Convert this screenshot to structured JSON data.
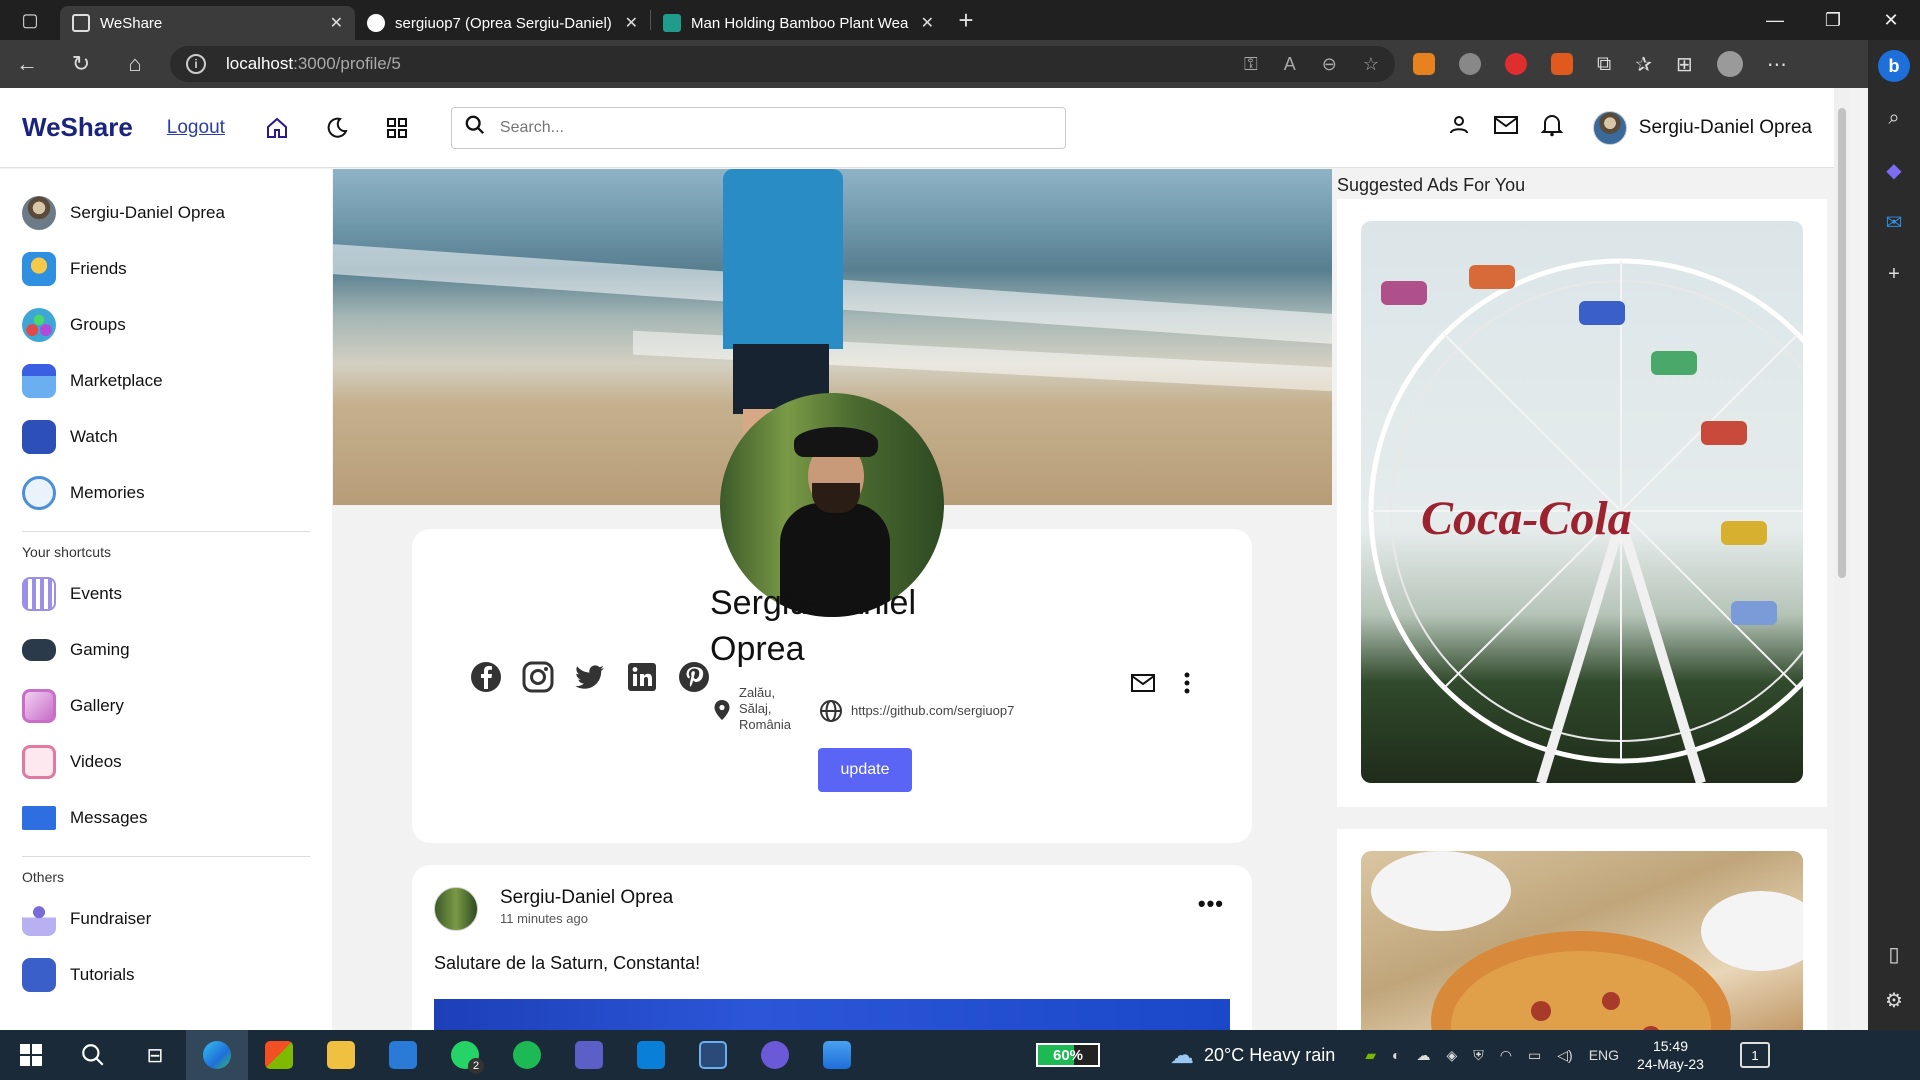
{
  "browser": {
    "tabs": [
      {
        "label": "WeShare",
        "active": true,
        "favicon_color": "#e8e8e8"
      },
      {
        "label": "sergiuop7 (Oprea Sergiu-Daniel)",
        "active": false,
        "favicon_color": "#ffffff"
      },
      {
        "label": "Man Holding Bamboo Plant Wea",
        "active": false,
        "favicon_color": "#1f9d8a"
      }
    ],
    "url_host": "localhost",
    "url_path": ":3000/profile/5"
  },
  "app": {
    "logo": "WeShare",
    "logout": "Logout",
    "search_placeholder": "Search...",
    "user_name": "Sergiu-Daniel Oprea"
  },
  "sidebar": {
    "main_items": [
      {
        "label": "Sergiu-Daniel Oprea",
        "icon": "user-avatar-icon",
        "color": "#6d7a88"
      },
      {
        "label": "Friends",
        "icon": "friends-icon",
        "color": "#2f8fe0"
      },
      {
        "label": "Groups",
        "icon": "groups-icon",
        "color": "#3fa7d6"
      },
      {
        "label": "Marketplace",
        "icon": "marketplace-icon",
        "color": "#3a7ce8"
      },
      {
        "label": "Watch",
        "icon": "watch-icon",
        "color": "#2c4fb8"
      },
      {
        "label": "Memories",
        "icon": "memories-icon",
        "color": "#4a8fd8"
      }
    ],
    "shortcuts_title": "Your shortcuts",
    "shortcuts": [
      {
        "label": "Events",
        "icon": "events-icon",
        "color": "#9b8fe8"
      },
      {
        "label": "Gaming",
        "icon": "gaming-icon",
        "color": "#2b3a4a"
      },
      {
        "label": "Gallery",
        "icon": "gallery-icon",
        "color": "#c86dc8"
      },
      {
        "label": "Videos",
        "icon": "videos-icon",
        "color": "#e07aa0"
      },
      {
        "label": "Messages",
        "icon": "messages-icon",
        "color": "#2d6fe0"
      }
    ],
    "others_title": "Others",
    "others": [
      {
        "label": "Fundraiser",
        "icon": "fundraiser-icon",
        "color": "#7a6ad8"
      },
      {
        "label": "Tutorials",
        "icon": "tutorials-icon",
        "color": "#3a5fc8"
      }
    ]
  },
  "profile": {
    "name": "Sergiu-Daniel Oprea",
    "location": "Zalău, Sălaj, România",
    "website": "https://github.com/sergiuop7",
    "update_label": "update"
  },
  "post": {
    "author": "Sergiu-Daniel Oprea",
    "time": "11 minutes ago",
    "text": "Salutare de la Saturn, Constanta!"
  },
  "ads": {
    "title": "Suggested Ads For You",
    "brand_text": "Coca-Cola"
  },
  "taskbar": {
    "battery": "60%",
    "weather": "20°C  Heavy rain",
    "language": "ENG",
    "time": "15:49",
    "date": "24-May-23",
    "whatsapp_badge": "2",
    "notifications": "1"
  }
}
